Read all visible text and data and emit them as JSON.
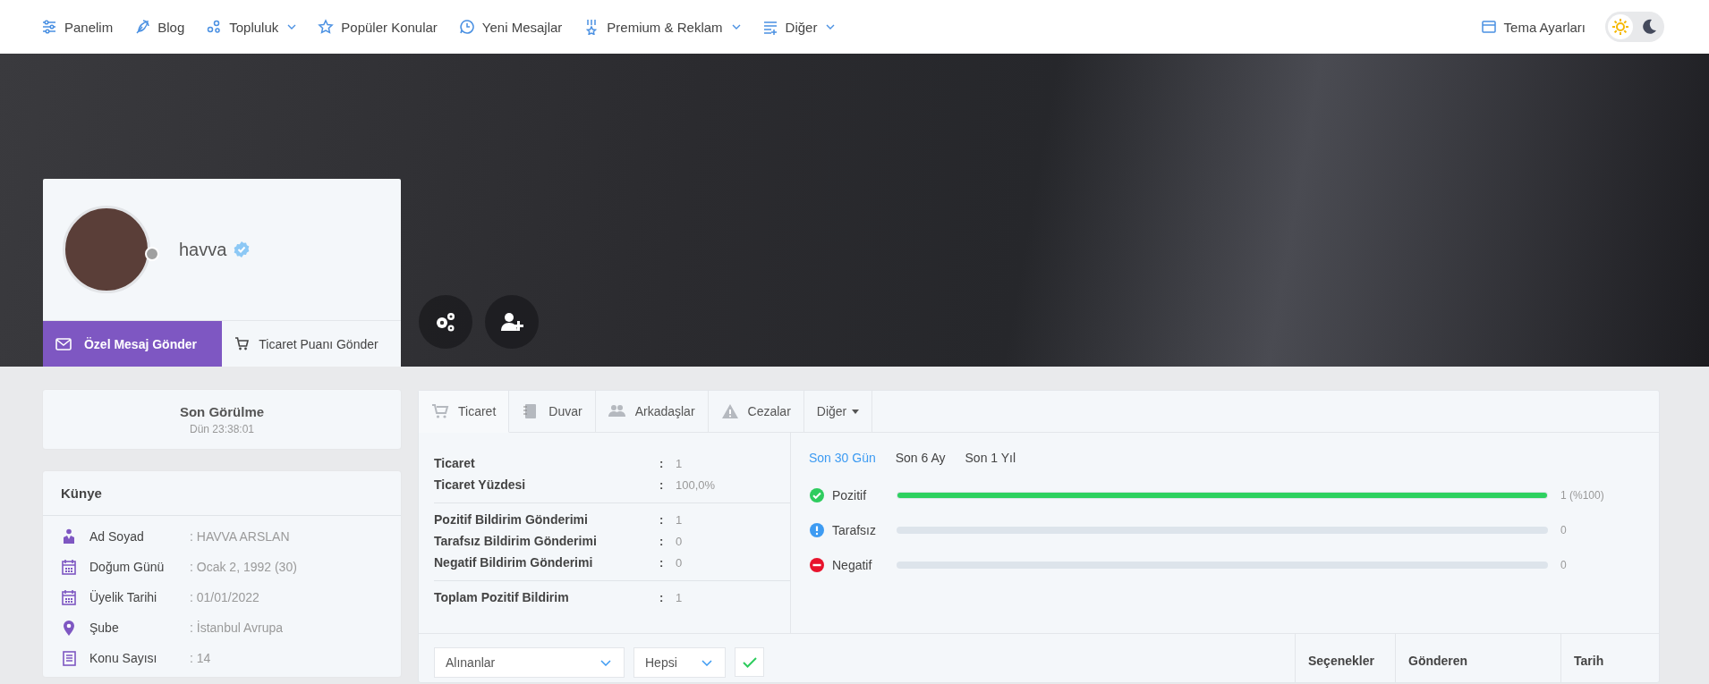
{
  "nav": {
    "items": [
      {
        "label": "Panelim",
        "dropdown": false
      },
      {
        "label": "Blog",
        "dropdown": false
      },
      {
        "label": "Topluluk",
        "dropdown": true
      },
      {
        "label": "Popüler Konular",
        "dropdown": false
      },
      {
        "label": "Yeni Mesajlar",
        "dropdown": false
      },
      {
        "label": "Premium & Reklam",
        "dropdown": true
      },
      {
        "label": "Diğer",
        "dropdown": true
      }
    ],
    "theme_settings": "Tema Ayarları",
    "theme_toggle": [
      {
        "kind": "light",
        "selected": true
      },
      {
        "kind": "dark",
        "selected": false
      }
    ]
  },
  "profile": {
    "username": "havva",
    "verified": true,
    "online": false,
    "actions": [
      {
        "label": "Özel Mesaj Gönder",
        "primary": true
      },
      {
        "label": "Ticaret Puanı Gönder",
        "primary": false
      }
    ]
  },
  "last_seen": {
    "title": "Son Görülme",
    "value": "Dün 23:38:01"
  },
  "kunye": {
    "title": "Künye",
    "rows": [
      {
        "label": "Ad Soyad",
        "value": ": HAVVA ARSLAN"
      },
      {
        "label": "Doğum Günü",
        "value": ": Ocak 2, 1992 (30)"
      },
      {
        "label": "Üyelik Tarihi",
        "value": ": 01/01/2022"
      },
      {
        "label": "Şube",
        "value": ": İstanbul Avrupa"
      },
      {
        "label": "Konu Sayısı",
        "value": ": 14"
      }
    ]
  },
  "tabs": [
    {
      "label": "Ticaret",
      "selected": true,
      "dropdown": false
    },
    {
      "label": "Duvar",
      "selected": false,
      "dropdown": false
    },
    {
      "label": "Arkadaşlar",
      "selected": false,
      "dropdown": false
    },
    {
      "label": "Cezalar",
      "selected": false,
      "dropdown": false
    },
    {
      "label": "Diğer",
      "selected": false,
      "dropdown": true
    }
  ],
  "stats": [
    [
      {
        "label": "Ticaret",
        "sep": ":",
        "value": "1"
      },
      {
        "label": "Ticaret Yüzdesi",
        "sep": ":",
        "value": "100,0%"
      }
    ],
    [
      {
        "label": "Pozitif Bildirim Gönderimi",
        "sep": ":",
        "value": "1"
      },
      {
        "label": "Tarafsız Bildirim Gönderimi",
        "sep": ":",
        "value": "0"
      },
      {
        "label": "Negatif Bildirim Gönderimi",
        "sep": ":",
        "value": "0"
      }
    ],
    [
      {
        "label": "Toplam Pozitif Bildirim",
        "sep": ":",
        "value": "1"
      }
    ]
  ],
  "periods": [
    {
      "label": "Son 30 Gün",
      "selected": true
    },
    {
      "label": "Son 6 Ay",
      "selected": false
    },
    {
      "label": "Son 1 Yıl",
      "selected": false
    }
  ],
  "ratings": [
    {
      "kind": "positive",
      "label": "Pozitif",
      "level": 1,
      "reading": "1 (%100)"
    },
    {
      "kind": "neutral",
      "label": "Tarafsız",
      "level": 0,
      "reading": "0"
    },
    {
      "kind": "negative",
      "label": "Negatif",
      "level": 0,
      "reading": "0"
    }
  ],
  "filters": [
    {
      "value": "Alınanlar"
    },
    {
      "value": "Hepsi"
    }
  ],
  "table": {
    "columns": [
      "Seçenekler",
      "Gönderen",
      "Tarih"
    ]
  }
}
